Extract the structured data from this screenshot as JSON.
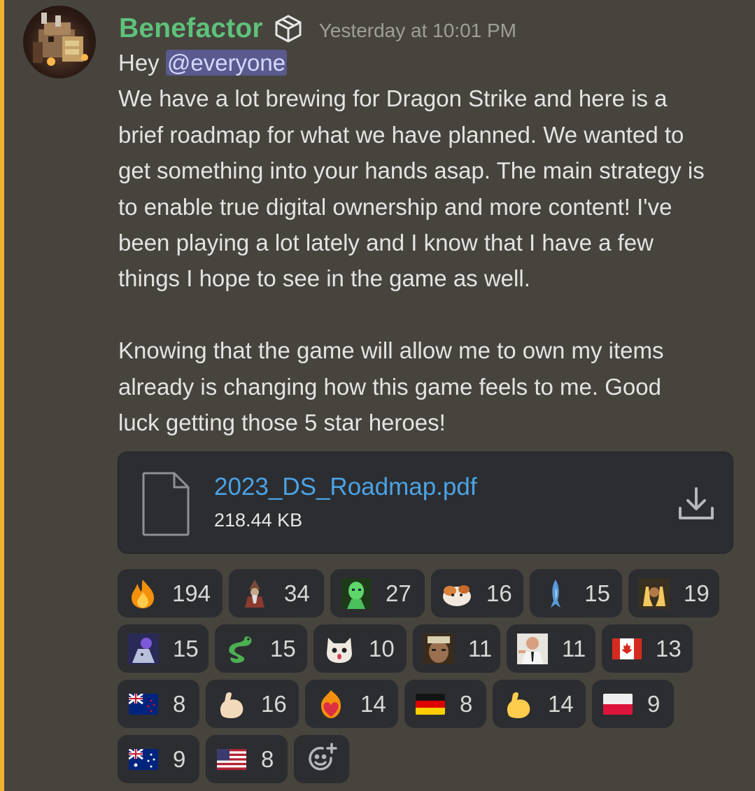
{
  "message": {
    "author": "Benefactor",
    "timestamp": "Yesterday at 10:01 PM",
    "greeting": "Hey ",
    "mention": "@everyone",
    "lines": [
      "We have a lot brewing for Dragon Strike and here is a",
      "brief roadmap for what we have planned.  We wanted to",
      "get something into your hands asap. The main strategy is",
      "to enable true digital ownership and more content! I've",
      "been playing a lot lately and I know that I have a few",
      "things I hope to see in the game as well.",
      "",
      "Knowing that the game will allow me to own my items",
      "already is changing how this game feels to me. Good",
      "luck getting those 5 star heroes!"
    ]
  },
  "attachment": {
    "file_name": "2023_DS_Roadmap.pdf",
    "file_size": "218.44 KB",
    "icon": "file-icon",
    "action_icon": "download-icon"
  },
  "reactions": [
    {
      "emoji": "fire",
      "count": "194"
    },
    {
      "emoji": "wizard",
      "count": "34"
    },
    {
      "emoji": "green-alien",
      "count": "27"
    },
    {
      "emoji": "hamster",
      "count": "16"
    },
    {
      "emoji": "shark",
      "count": "15"
    },
    {
      "emoji": "praise-hands",
      "count": "19"
    },
    {
      "emoji": "ghost-character",
      "count": "15"
    },
    {
      "emoji": "dragon",
      "count": "15"
    },
    {
      "emoji": "shocked-cat",
      "count": "10"
    },
    {
      "emoji": "man-face",
      "count": "11"
    },
    {
      "emoji": "excited-man",
      "count": "11"
    },
    {
      "emoji": "canada-flag",
      "count": "13"
    },
    {
      "emoji": "new-zealand-flag",
      "count": "8"
    },
    {
      "emoji": "flexed-biceps-light",
      "count": "16"
    },
    {
      "emoji": "heart-on-fire",
      "count": "14"
    },
    {
      "emoji": "germany-flag",
      "count": "8"
    },
    {
      "emoji": "flexed-biceps",
      "count": "14"
    },
    {
      "emoji": "poland-flag",
      "count": "9"
    },
    {
      "emoji": "australia-flag",
      "count": "9"
    },
    {
      "emoji": "usa-flag",
      "count": "8"
    }
  ],
  "add_reaction_icon": "add-reaction-icon",
  "colors": {
    "accent": "#f0b232",
    "username": "#5ec27a",
    "link": "#4ba3e6",
    "mention_bg": "#5a5a8e"
  }
}
